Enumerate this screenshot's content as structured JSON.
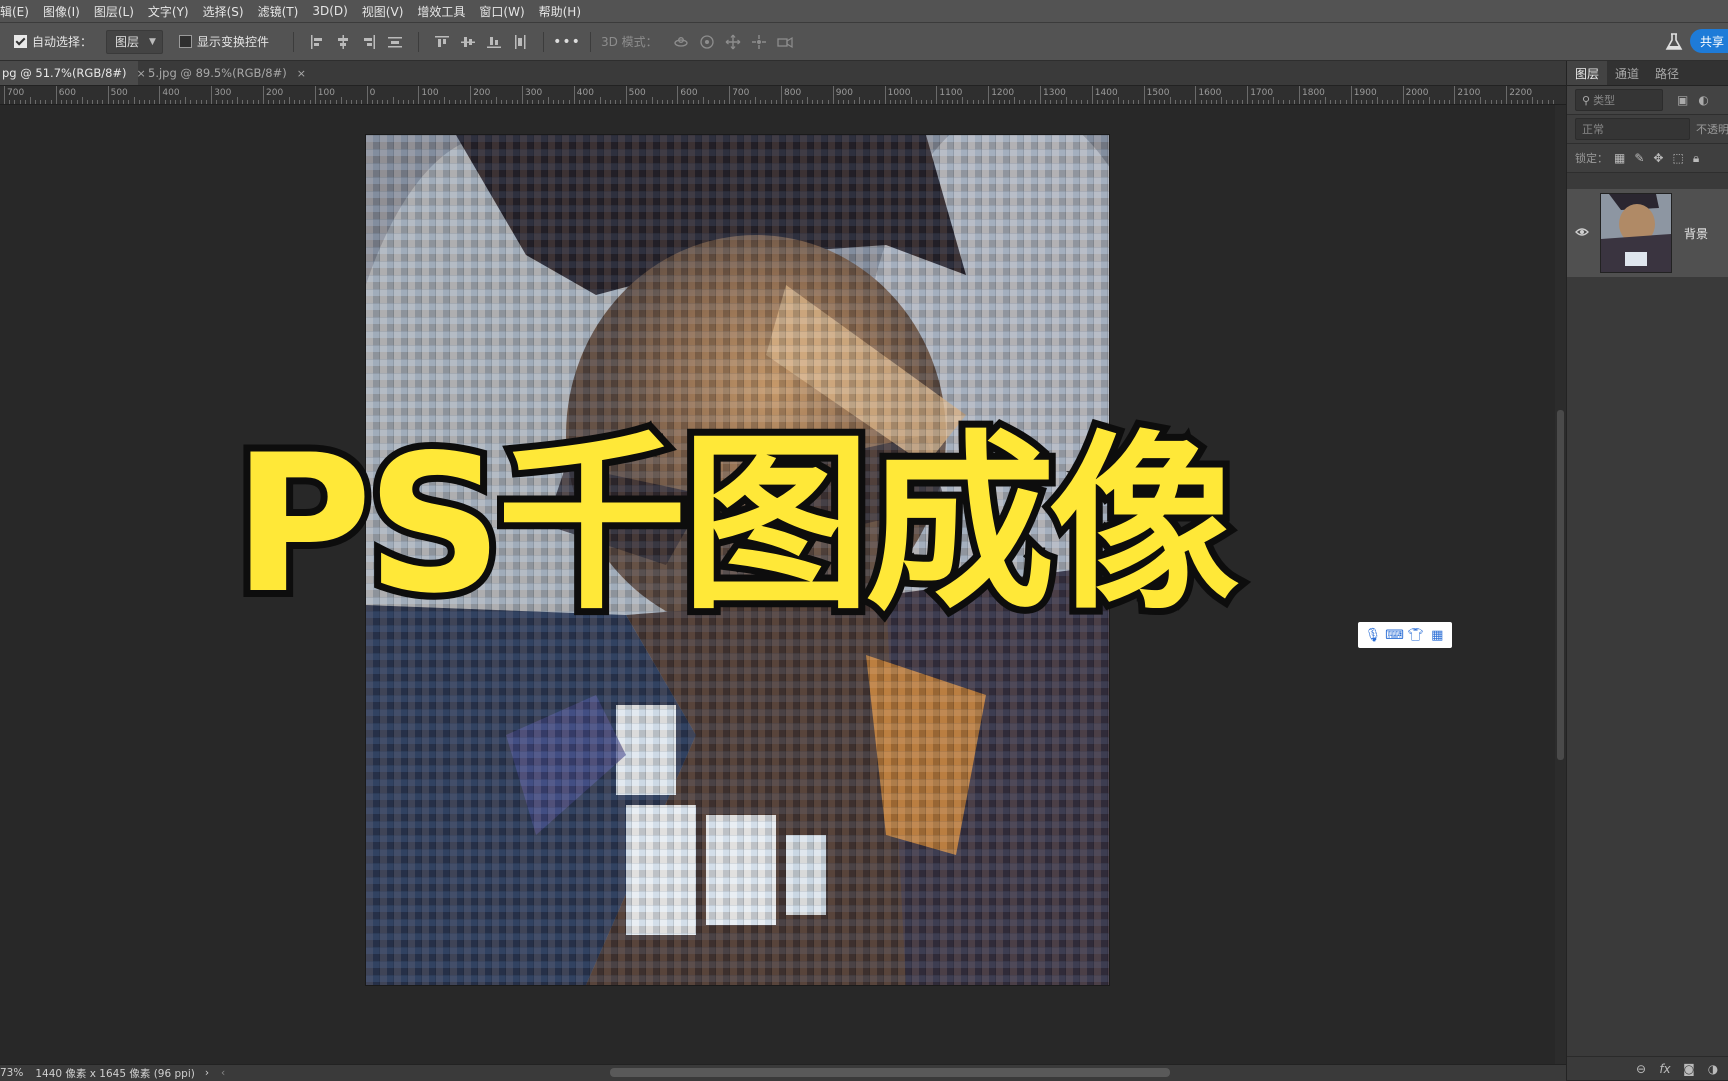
{
  "menubar": {
    "items": [
      "辑(E)",
      "图像(I)",
      "图层(L)",
      "文字(Y)",
      "选择(S)",
      "滤镜(T)",
      "3D(D)",
      "视图(V)",
      "增效工具",
      "窗口(W)",
      "帮助(H)"
    ]
  },
  "options": {
    "auto_select_label": "自动选择：",
    "auto_select_checked": true,
    "auto_select_target": "图层",
    "show_transform_label": "显示变换控件",
    "show_transform_checked": false,
    "mode3d_label": "3D 模式：",
    "share_label": "共享"
  },
  "tabs": [
    {
      "label": "pg @ 51.7%(RGB/8#)",
      "active": true
    },
    {
      "label": "5.jpg @ 89.5%(RGB/8#)",
      "active": false
    }
  ],
  "ruler": {
    "labels": [
      "700",
      "600",
      "500",
      "400",
      "300",
      "200",
      "100",
      "0",
      "100",
      "200",
      "300",
      "400",
      "500",
      "600",
      "700",
      "800",
      "900",
      "1000",
      "1100",
      "1200",
      "1300",
      "1400",
      "1500",
      "1600",
      "1700",
      "1800",
      "1900",
      "2000",
      "2100",
      "2200"
    ]
  },
  "status": {
    "zoom": "73%",
    "doc_info": "1440 像素 x 1645 像素 (96 ppi)"
  },
  "overlay": {
    "title": "PS千图成像"
  },
  "layers_panel": {
    "tabs": [
      "图层",
      "通道",
      "路径"
    ],
    "filter_placeholder": "类型",
    "blend_mode": "正常",
    "opacity_label": "不透明",
    "lock_label": "锁定：",
    "layers": [
      {
        "name": "背景",
        "visible": true
      }
    ],
    "footer_icons": [
      "link-icon",
      "fx-icon",
      "mask-icon",
      "adjustment-icon"
    ]
  },
  "ime_toolbar": {
    "icons": [
      "microphone-icon",
      "keyboard-icon",
      "skin-icon",
      "grid-icon"
    ]
  },
  "colors": {
    "title_fill": "#ffe838",
    "title_stroke": "#0d0d0d",
    "accent": "#1e7bd8",
    "chrome": "#535353"
  }
}
